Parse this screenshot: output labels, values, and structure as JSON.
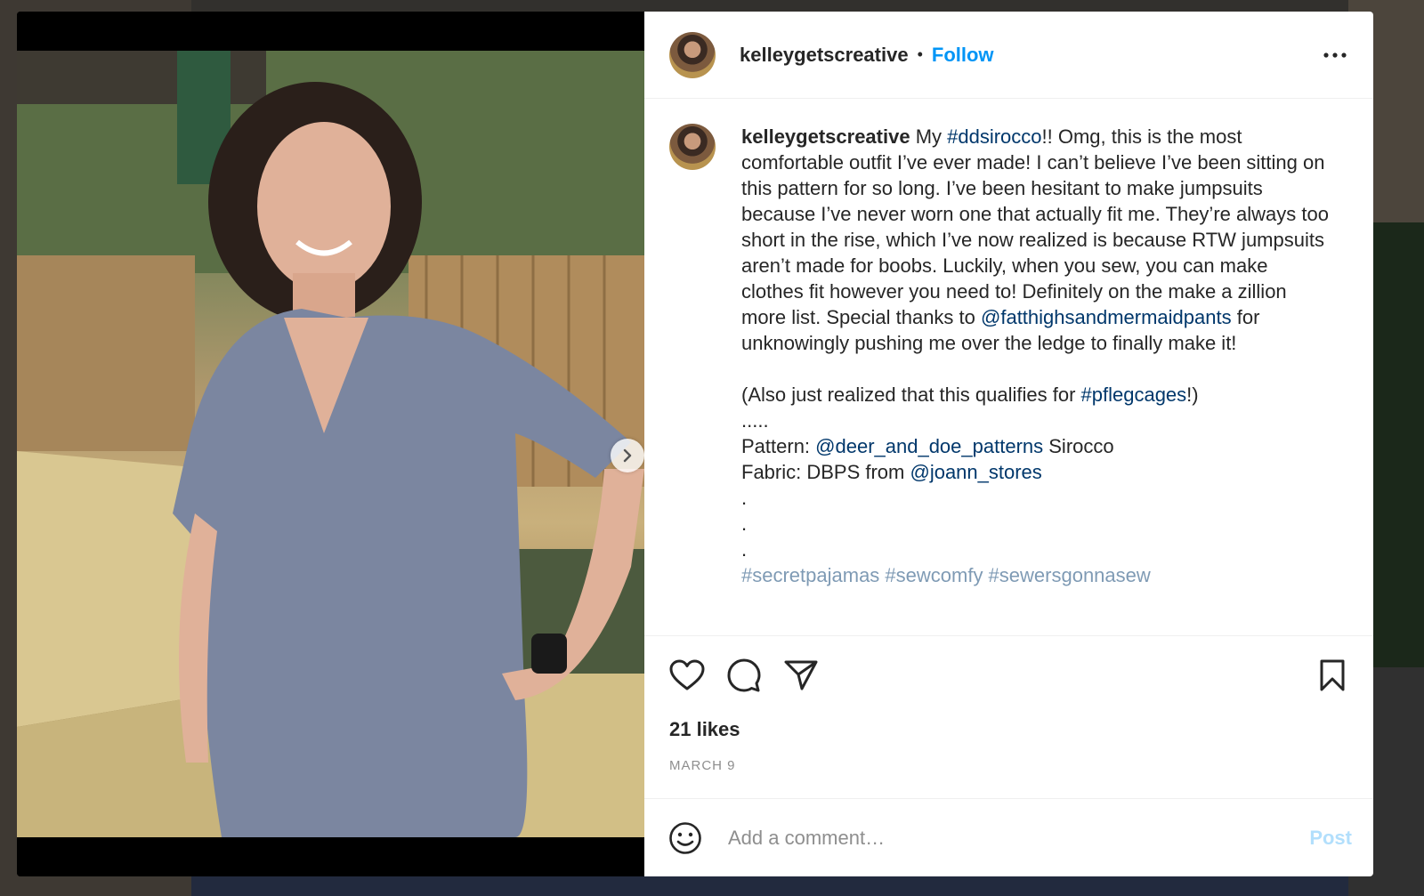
{
  "post": {
    "username": "kelleygetscreative",
    "follow_label": "Follow",
    "header_separator": "•",
    "caption": {
      "username": "kelleygetscreative",
      "t1": " My ",
      "tag1": "#ddsirocco",
      "t2": "!! Omg, this is the most comfortable outfit I’ve ever made! I can’t believe I’ve been sitting on this pattern for so long. I’ve been hesitant to make jumpsuits because I’ve never worn one that actually fit me. They’re always too short in the rise, which I’ve now realized is because RTW jumpsuits aren’t made for boobs. Luckily, when you sew, you can make clothes fit however you need to! Definitely on the make a zillion more list. Special thanks to ",
      "mention1": "@fatthighsandmermaidpants",
      "t3": " for unknowingly pushing me over the ledge to finally make it!\n\n(Also just realized that this qualifies for ",
      "tag2": "#pflegcages",
      "t4": "!)\n.....\nPattern: ",
      "mention2": "@deer_and_doe_patterns",
      "t5": " Sirocco\nFabric: DBPS from ",
      "mention3": "@joann_stores",
      "t6": "\n.\n.\n.\n",
      "tags_cut": "#secretpajamas #sewcomfy #sewersgonnasew"
    },
    "likes": "21 likes",
    "date": "MARCH 9",
    "comment_placeholder": "Add a comment…",
    "post_label": "Post"
  },
  "colors": {
    "link": "#00376b",
    "follow": "#0095f6",
    "post_disabled": "#b2dffc"
  },
  "icons": {
    "more": "more-dots-icon",
    "like": "heart-icon",
    "comment": "comment-bubble-icon",
    "share": "paper-plane-icon",
    "save": "bookmark-icon",
    "emoji": "emoji-icon",
    "next": "chevron-right-icon"
  },
  "carousel": {
    "total": 3,
    "active": 1
  }
}
